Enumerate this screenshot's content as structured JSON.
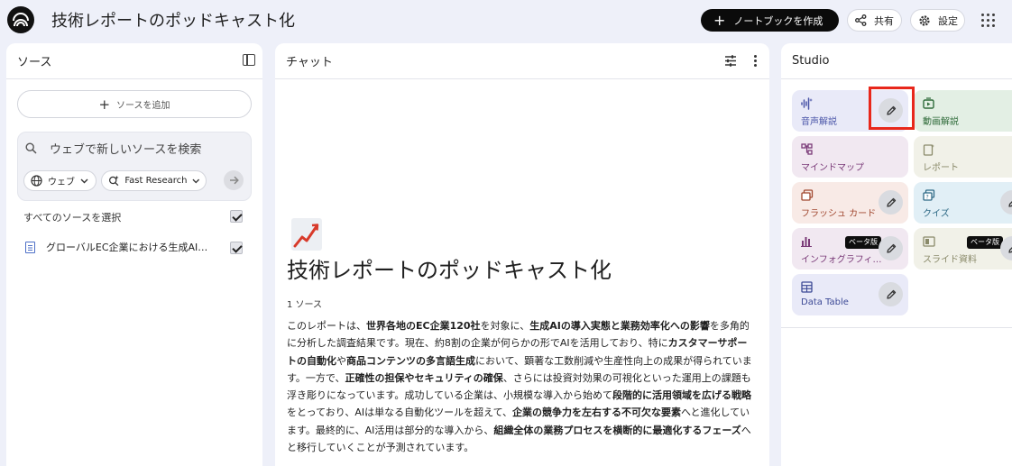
{
  "header": {
    "title": "技術レポートのポッドキャスト化",
    "create_label": "ノートブックを作成",
    "share_label": "共有",
    "settings_label": "設定"
  },
  "sources": {
    "title": "ソース",
    "add_label": "ソースを追加",
    "search_placeholder": "ウェブで新しいソースを検索",
    "chip_web": "ウェブ",
    "chip_research": "Fast Research",
    "select_all": "すべてのソースを選択",
    "items": [
      {
        "label": "グローバルEC企業における生成AI活用…"
      }
    ]
  },
  "chat": {
    "title": "チャット",
    "emoji": "📈",
    "doc_title": "技術レポートのポッドキャスト化",
    "source_count": "1 ソース",
    "summary": [
      {
        "t": "このレポートは、"
      },
      {
        "t": "世界各地のEC企業120社",
        "b": true
      },
      {
        "t": "を対象に、"
      },
      {
        "t": "生成AIの導入実態と業務効率化への影響",
        "b": true
      },
      {
        "t": "を多角的に分析した調査結果です。現在、約8割の企業が何らかの形でAIを活用しており、特に"
      },
      {
        "t": "カスタマーサポートの自動化",
        "b": true
      },
      {
        "t": "や"
      },
      {
        "t": "商品コンテンツの多言語生成",
        "b": true
      },
      {
        "t": "において、顕著な工数削減や生産性向上の成果が得られています。一方で、"
      },
      {
        "t": "正確性の担保やセキュリティの確保",
        "b": true
      },
      {
        "t": "、さらには投資対効果の可視化といった運用上の課題も浮き彫りになっています。成功している企業は、小規模な導入から始めて"
      },
      {
        "t": "段階的に活用領域を広げる戦略",
        "b": true
      },
      {
        "t": "をとっており、AIは単なる自動化ツールを超えて、"
      },
      {
        "t": "企業の競争力を左右する不可欠な要素",
        "b": true
      },
      {
        "t": "へと進化しています。最終的に、AI活用は部分的な導入から、"
      },
      {
        "t": "組織全体の業務プロセスを横断的に最適化するフェーズ",
        "b": true
      },
      {
        "t": "へと移行していくことが予測されています。"
      }
    ]
  },
  "studio": {
    "title": "Studio",
    "beta_label": "ベータ版",
    "cards": [
      {
        "label": "音声解説",
        "icon": "audio-wave-icon",
        "bg": "#e9eaf8",
        "color": "#4a55a8",
        "edit": true
      },
      {
        "label": "動画解説",
        "icon": "video-icon",
        "bg": "#e3efe4",
        "color": "#2f6b3a",
        "edit": false
      },
      {
        "label": "マインドマップ",
        "icon": "mindmap-icon",
        "bg": "#f1e8f1",
        "color": "#7a3a78",
        "edit": false
      },
      {
        "label": "レポート",
        "icon": "report-icon",
        "bg": "#f1f1e8",
        "color": "#8a8a6a",
        "edit": false
      },
      {
        "label": "フラッシュ カード",
        "icon": "flashcard-icon",
        "bg": "#f8eae6",
        "color": "#a0472f",
        "edit": true
      },
      {
        "label": "クイズ",
        "icon": "quiz-icon",
        "bg": "#e1eff6",
        "color": "#2f6a86",
        "edit": true
      },
      {
        "label": "インフォグラフィ…",
        "icon": "infographic-icon",
        "bg": "#f1e8f1",
        "color": "#7a3a78",
        "edit": true,
        "beta": true
      },
      {
        "label": "スライド資料",
        "icon": "slides-icon",
        "bg": "#f1f1e8",
        "color": "#8a8a6a",
        "edit": true,
        "beta": true
      },
      {
        "label": "Data Table",
        "icon": "table-icon",
        "bg": "#e9eaf8",
        "color": "#3d4a96",
        "edit": true
      }
    ]
  },
  "highlight_color": "#e8271b"
}
